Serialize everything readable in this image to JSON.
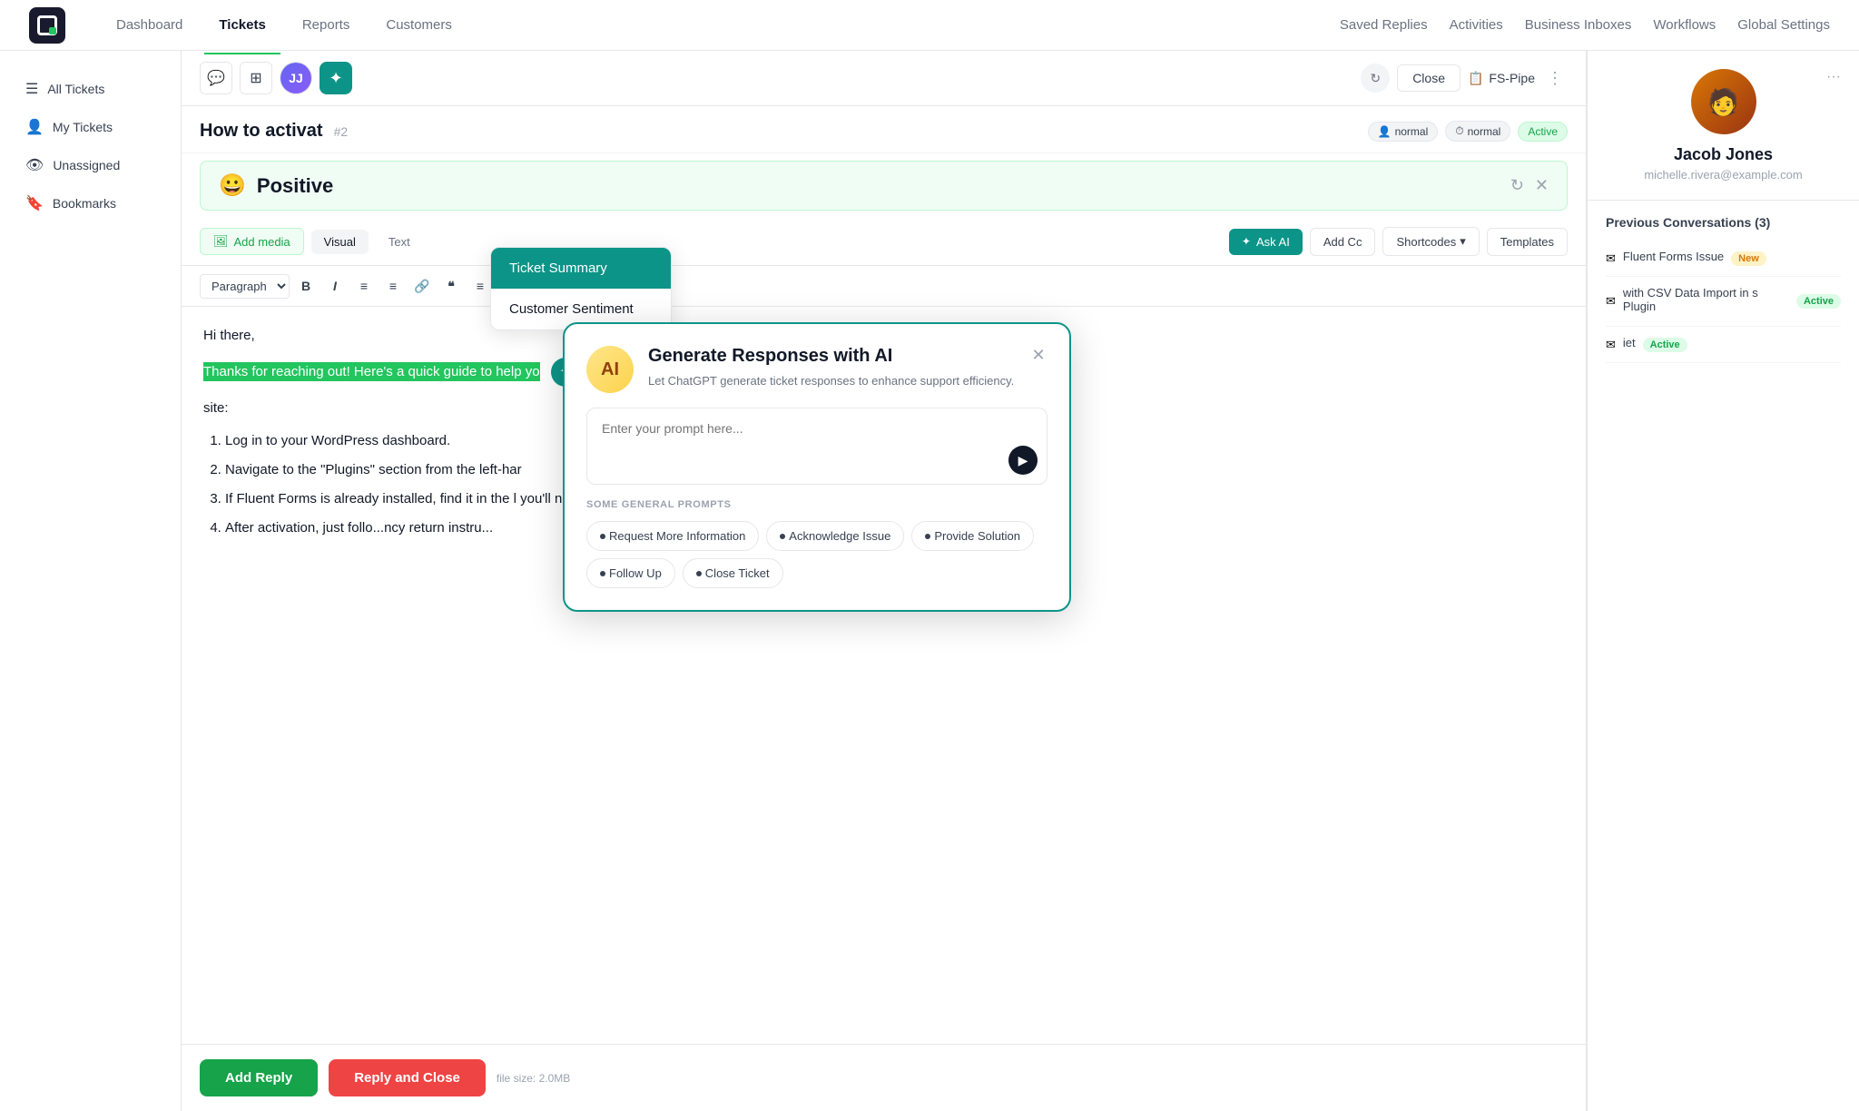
{
  "nav": {
    "logo_alt": "E",
    "links": [
      "Dashboard",
      "Tickets",
      "Reports",
      "Customers"
    ],
    "active_link": "Tickets",
    "right_links": [
      "Saved Replies",
      "Activities",
      "Business Inboxes",
      "Workflows",
      "Global Settings"
    ]
  },
  "sidebar": {
    "items": [
      {
        "label": "All Tickets",
        "icon": "☰",
        "active": false
      },
      {
        "label": "My Tickets",
        "icon": "👤",
        "active": false
      },
      {
        "label": "Unassigned",
        "icon": "👁",
        "active": false
      },
      {
        "label": "Bookmarks",
        "icon": "🔖",
        "active": false
      }
    ]
  },
  "ticket": {
    "title": "How to activat",
    "number": "#2",
    "badges": [
      {
        "label": "normal",
        "type": "normal"
      },
      {
        "label": "normal",
        "type": "normal"
      },
      {
        "label": "Active",
        "type": "active"
      }
    ],
    "inbox_label": "FS-Pipe",
    "close_btn": "Close"
  },
  "ai_tooltip": {
    "items": [
      "Ticket Summary",
      "Customer Sentiment"
    ]
  },
  "sentiment": {
    "emoji": "😀",
    "label": "Positive"
  },
  "reply_toolbar": {
    "add_media": "Add media",
    "view_visual": "Visual",
    "view_text": "Text",
    "ask_ai": "Ask AI",
    "add_cc": "Add Cc",
    "shortcodes": "Shortcodes",
    "templates": "Templates"
  },
  "format_toolbar": {
    "paragraph": "Paragraph",
    "buttons": [
      "B",
      "I",
      "≡",
      "≡",
      "🔗",
      "❝",
      "≡",
      "≡",
      "≡"
    ]
  },
  "editor": {
    "greeting": "Hi there,",
    "highlighted": "Thanks for reaching out! Here's a quick guide to help yo",
    "suffix": "site:",
    "steps": [
      "Log in to your WordPress dashboard.",
      "Navigate to the \"Plugins\" section from the left-har",
      "If Fluent Forms is already installed, find it in the l you'll need to install it first. Simply click \"Add Nev then install and activate it.",
      "After activation, just follo...ncy return instru..."
    ]
  },
  "action_bar": {
    "add_reply": "Add Reply",
    "reply_close": "Reply and Close",
    "file_info": "file size: 2.0MB"
  },
  "ai_modal": {
    "title": "Generate Responses with AI",
    "description": "Let ChatGPT generate ticket responses to enhance support efficiency.",
    "icon_label": "AI",
    "placeholder": "Enter your prompt here...",
    "prompts_label": "SOME GENERAL PROMPTS",
    "chips": [
      "Request More Information",
      "Acknowledge Issue",
      "Provide Solution",
      "Follow Up",
      "Close Ticket"
    ]
  },
  "customer": {
    "name": "Jacob Jones",
    "email": "michelle.rivera@example.com",
    "avatar_emoji": "🧑"
  },
  "prev_conversations": {
    "title": "Previous Conversations (3)",
    "items": [
      {
        "title": "Fluent Forms Issue",
        "badge": "New",
        "badge_type": "new"
      },
      {
        "title": "with CSV Data Import in s Plugin",
        "badge": "Active",
        "badge_type": "active"
      },
      {
        "title": "iet",
        "badge": "Active",
        "badge_type": "active"
      }
    ]
  },
  "colors": {
    "teal": "#0d9488",
    "green": "#16a34a",
    "red": "#ef4444"
  }
}
